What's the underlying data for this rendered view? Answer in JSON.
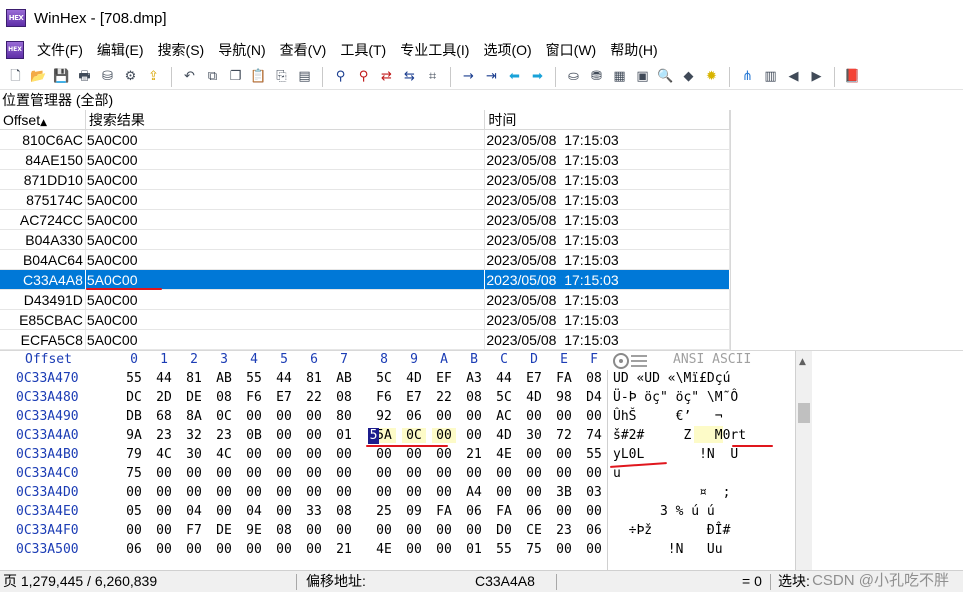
{
  "app": {
    "icon_text": "HEX",
    "title": "WinHex - [708.dmp]"
  },
  "menu": [
    "文件(F)",
    "编辑(E)",
    "搜索(S)",
    "导航(N)",
    "查看(V)",
    "工具(T)",
    "专业工具(I)",
    "选项(O)",
    "窗口(W)",
    "帮助(H)"
  ],
  "toolbar_icons": [
    "new-file-icon",
    "open-icon",
    "save-icon",
    "print-icon",
    "copy-disk-icon",
    "properties-icon",
    "export-icon",
    "sep",
    "undo-icon",
    "copy-block-icon",
    "copy-icon",
    "paste-icon",
    "paste-hex-icon",
    "hex-data-icon",
    "sep",
    "find-text-icon",
    "find-hex-icon",
    "replace-text-icon",
    "replace-hex-icon",
    "hex-values-icon",
    "sep",
    "goto-offset-icon",
    "goto-sector-icon",
    "back-icon",
    "forward-icon",
    "sep",
    "disk-icon",
    "disk-edit-icon",
    "ram-icon",
    "calculator-icon",
    "magnifier-icon",
    "cube-icon",
    "sun-icon",
    "sep",
    "tree-icon",
    "table-icon",
    "prev-icon",
    "next-icon",
    "sep",
    "book-icon"
  ],
  "position_manager": {
    "title": "位置管理器 (全部)",
    "columns": [
      "Offset",
      "搜索结果",
      "时间"
    ],
    "sort_arrow": "▲",
    "rows": [
      {
        "offset": "810C6AC",
        "result": "5A0C00",
        "time": "2023/05/08  17:15:03"
      },
      {
        "offset": "84AE150",
        "result": "5A0C00",
        "time": "2023/05/08  17:15:03"
      },
      {
        "offset": "871DD10",
        "result": "5A0C00",
        "time": "2023/05/08  17:15:03"
      },
      {
        "offset": "875174C",
        "result": "5A0C00",
        "time": "2023/05/08  17:15:03"
      },
      {
        "offset": "AC724CC",
        "result": "5A0C00",
        "time": "2023/05/08  17:15:03"
      },
      {
        "offset": "B04A330",
        "result": "5A0C00",
        "time": "2023/05/08  17:15:03"
      },
      {
        "offset": "B04AC64",
        "result": "5A0C00",
        "time": "2023/05/08  17:15:03"
      },
      {
        "offset": "C33A4A8",
        "result": "5A0C00",
        "time": "2023/05/08  17:15:03",
        "selected": true
      },
      {
        "offset": "D43491D",
        "result": "5A0C00",
        "time": "2023/05/08  17:15:03"
      },
      {
        "offset": "E85CBAC",
        "result": "5A0C00",
        "time": "2023/05/08  17:15:03"
      },
      {
        "offset": "ECFA5C8",
        "result": "5A0C00",
        "time": "2023/05/08  17:15:03"
      }
    ]
  },
  "hex": {
    "offset_label": "Offset",
    "col_headers": [
      "0",
      "1",
      "2",
      "3",
      "4",
      "5",
      "6",
      "7",
      "8",
      "9",
      "A",
      "B",
      "C",
      "D",
      "E",
      "F"
    ],
    "ansi_label": "ANSI ASCII",
    "rows": [
      {
        "offset": "0C33A470",
        "bytes": [
          "55",
          "44",
          "81",
          "AB",
          "55",
          "44",
          "81",
          "AB",
          "5C",
          "4D",
          "EF",
          "A3",
          "44",
          "E7",
          "FA",
          "08"
        ],
        "ansi": "UD «UD «\\Mï£Dçú"
      },
      {
        "offset": "0C33A480",
        "bytes": [
          "DC",
          "2D",
          "DE",
          "08",
          "F6",
          "E7",
          "22",
          "08",
          "F6",
          "E7",
          "22",
          "08",
          "5C",
          "4D",
          "98",
          "D4"
        ],
        "ansi": "Ü-Þ öç\" öç\" \\M˜Ô"
      },
      {
        "offset": "0C33A490",
        "bytes": [
          "DB",
          "68",
          "8A",
          "0C",
          "00",
          "00",
          "00",
          "80",
          "92",
          "06",
          "00",
          "00",
          "AC",
          "00",
          "00",
          "00"
        ],
        "ansi": "ÛhŠ     €’   ¬"
      },
      {
        "offset": "0C33A4A0",
        "bytes": [
          "9A",
          "23",
          "32",
          "23",
          "0B",
          "00",
          "00",
          "01",
          "5A",
          "0C",
          "00",
          "00",
          "4D",
          "30",
          "72",
          "74"
        ],
        "ansi": "š#2#     Z   M0rt"
      },
      {
        "offset": "0C33A4B0",
        "bytes": [
          "79",
          "4C",
          "30",
          "4C",
          "00",
          "00",
          "00",
          "00",
          "00",
          "00",
          "00",
          "21",
          "4E",
          "00",
          "00",
          "55"
        ],
        "ansi": "yL0L       !N  U"
      },
      {
        "offset": "0C33A4C0",
        "bytes": [
          "75",
          "00",
          "00",
          "00",
          "00",
          "00",
          "00",
          "00",
          "00",
          "00",
          "00",
          "00",
          "00",
          "00",
          "00",
          "00"
        ],
        "ansi": "u"
      },
      {
        "offset": "0C33A4D0",
        "bytes": [
          "00",
          "00",
          "00",
          "00",
          "00",
          "00",
          "00",
          "00",
          "00",
          "00",
          "00",
          "A4",
          "00",
          "00",
          "3B",
          "03"
        ],
        "ansi": "           ¤  ;"
      },
      {
        "offset": "0C33A4E0",
        "bytes": [
          "05",
          "00",
          "04",
          "00",
          "04",
          "00",
          "33",
          "08",
          "25",
          "09",
          "FA",
          "06",
          "FA",
          "06",
          "00",
          "00"
        ],
        "ansi": "      3 % ú ú"
      },
      {
        "offset": "0C33A4F0",
        "bytes": [
          "00",
          "00",
          "F7",
          "DE",
          "9E",
          "08",
          "00",
          "00",
          "00",
          "00",
          "00",
          "00",
          "D0",
          "CE",
          "23",
          "06"
        ],
        "ansi": "  ÷Þž       ĐÎ#"
      },
      {
        "offset": "0C33A500",
        "bytes": [
          "06",
          "00",
          "00",
          "00",
          "00",
          "00",
          "00",
          "21",
          "4E",
          "00",
          "00",
          "01",
          "55",
          "75",
          "00",
          "00"
        ],
        "ansi": "       !N   Uu"
      }
    ],
    "cursor_char": "5"
  },
  "status": {
    "page": "页 1,279,445 / 6,260,839",
    "offset_label": "偏移地址:",
    "offset_value": "C33A4A8",
    "eq": "= 0",
    "sel_label": "选块:",
    "watermark": "CSDN @小孔吃不胖"
  },
  "colors": {
    "selection": "#0078d7",
    "offset_blue": "#1c3db5",
    "highlight_yellow": "#fdfbc8",
    "annotation_red": "#e0161d"
  }
}
